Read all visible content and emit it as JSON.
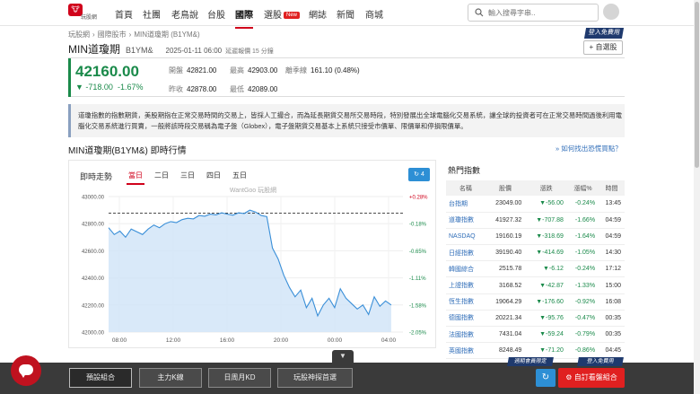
{
  "header": {
    "logo_text": "玩股網",
    "nav": [
      "首頁",
      "社團",
      "老鳥說",
      "台股",
      "國際",
      "選股",
      "網誌",
      "新聞",
      "商城"
    ],
    "new_badge": "New",
    "search_placeholder": "輸入搜尋字串.."
  },
  "breadcrumb": [
    "玩股網",
    "›",
    "國際股市",
    "›",
    "MIN道瓊期 (B1YM&)"
  ],
  "title": {
    "name": "MIN道瓊期",
    "code": "B1YM&",
    "datetime": "2025-01-11 06:00",
    "delay": "延遲報價 15 分鐘"
  },
  "member_tag": "登入免費用",
  "watch_button": "+ 自選股",
  "quote": {
    "price": "42160.00",
    "change": "▼ -718.00",
    "change_pct": "-1.67%",
    "fields": [
      {
        "k": "開盤",
        "v": "42821.00"
      },
      {
        "k": "最高",
        "v": "42903.00"
      },
      {
        "k": "離季線",
        "v": "161.10 (0.48%)"
      },
      {
        "k": "昨收",
        "v": "42878.00"
      },
      {
        "k": "最低",
        "v": "42089.00"
      }
    ]
  },
  "description": "道瓊指數的指數期貨，美股期指在正常交易時間的交易上，皆採人工撮合，而為延長期貨交易所交易時段，特別發展出全球電腦化交易系統，讓全球的投資者可在正常交易時間過後利用電腦化交易系統進行買賣，一般將該時段交易稱為電子盤（Globex），電子盤期貨交易基本上系統只接受市價單、限價單和停損限價單。",
  "section_title": "MIN道瓊期(B1YM&) 即時行情",
  "section_link": "» 如何找出恐慌買點？",
  "chart_panel": {
    "title": "即時走勢",
    "tabs": [
      "當日",
      "二日",
      "三日",
      "四日",
      "五日"
    ],
    "refresh_label": "4",
    "watermark": "WantGoo 玩股網"
  },
  "chart_data": {
    "type": "line",
    "x_labels": [
      "08:00",
      "12:00",
      "16:00",
      "20:00",
      "00:00",
      "04:00"
    ],
    "y_ticks": [
      43000,
      42800,
      42600,
      42400,
      42200,
      42000
    ],
    "y_labels": [
      "43000.00",
      "42800.00",
      "42600.00",
      "42400.00",
      "42200.00",
      "42000.00"
    ],
    "pct_labels": [
      "+0.28%",
      "-0.18%",
      "-0.65%",
      "-1.11%",
      "-1.58%",
      "-2.05%"
    ],
    "ylim": [
      42000,
      43000
    ],
    "reference": 42878,
    "series": [
      {
        "values": [
          42770,
          42720,
          42745,
          42700,
          42760,
          42740,
          42720,
          42760,
          42790,
          42770,
          42800,
          42815,
          42808,
          42830,
          42840,
          42835,
          42860,
          42855,
          42870,
          42865,
          42880,
          42870,
          42862,
          42880,
          42875,
          42900,
          42886,
          42860,
          42852,
          42620,
          42540,
          42420,
          42330,
          42260,
          42310,
          42180,
          42250,
          42120,
          42200,
          42250,
          42180,
          42320,
          42250,
          42210,
          42170,
          42200,
          42130,
          42260,
          42190,
          42230,
          42200
        ]
      }
    ],
    "grid": true
  },
  "sidebar": {
    "title": "熱門指數",
    "columns": [
      "名稱",
      "股價",
      "漲跌",
      "漲幅%",
      "時間"
    ],
    "rows": [
      [
        "台指期",
        "23049.00",
        "▼-56.00",
        "-0.24%",
        "13:45"
      ],
      [
        "道瓊指數",
        "41927.32",
        "▼-707.88",
        "-1.66%",
        "04:59"
      ],
      [
        "NASDAQ",
        "19160.19",
        "▼-318.69",
        "-1.64%",
        "04:59"
      ],
      [
        "日經指數",
        "39190.40",
        "▼-414.69",
        "-1.05%",
        "14:30"
      ],
      [
        "韓國綜合",
        "2515.78",
        "▼-6.12",
        "-0.24%",
        "17:12"
      ],
      [
        "上證指數",
        "3168.52",
        "▼-42.87",
        "-1.33%",
        "15:00"
      ],
      [
        "恆生指數",
        "19064.29",
        "▼-176.60",
        "-0.92%",
        "16:08"
      ],
      [
        "德國指數",
        "20221.34",
        "▼-95.76",
        "-0.47%",
        "00:35"
      ],
      [
        "法國指數",
        "7431.04",
        "▼-59.24",
        "-0.79%",
        "00:35"
      ],
      [
        "英國指數",
        "8248.49",
        "▼-71.20",
        "-0.86%",
        "04:45"
      ]
    ]
  },
  "bottom_bar": {
    "buttons": [
      "預設組合",
      "主力K線",
      "日周月KD",
      "玩股神探首選"
    ],
    "toggle": "▼",
    "last_data_tag": "週期會員限定",
    "member_tag": "登入免費用",
    "custom_button": "自訂看盤組合"
  },
  "colors": {
    "brand": "#d0021b",
    "down": "#1a8a4a",
    "link": "#2f6db8"
  }
}
